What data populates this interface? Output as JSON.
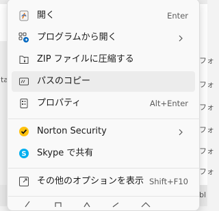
{
  "background": {
    "right_fragments": [
      "ta",
      "フォ",
      "フォ",
      "フォ",
      "フォ",
      "フォ",
      "フォ",
      "bl"
    ]
  },
  "menu": {
    "items": [
      {
        "label": "開く",
        "shortcut": "Enter",
        "icon": "open-with-app-icon"
      },
      {
        "label": "プログラムから開く",
        "shortcut": "",
        "icon": "open-with-program-icon",
        "submenu": true
      },
      {
        "label": "ZIP ファイルに圧縮する",
        "shortcut": "",
        "icon": "zip-icon"
      },
      {
        "label": "パスのコピー",
        "shortcut": "",
        "icon": "copy-path-icon"
      },
      {
        "label": "プロパティ",
        "shortcut": "Alt+Enter",
        "icon": "properties-icon"
      },
      {
        "label": "Norton Security",
        "shortcut": "",
        "icon": "norton-icon",
        "submenu": true
      },
      {
        "label": "Skype で共有",
        "shortcut": "",
        "icon": "skype-icon"
      },
      {
        "label": "その他のオプションを表示",
        "shortcut": "Shift+F10",
        "icon": "more-options-icon"
      }
    ]
  },
  "colors": {
    "accent": "#0067c0",
    "norton_yellow": "#ffc20e",
    "skype_blue": "#00aff0"
  }
}
